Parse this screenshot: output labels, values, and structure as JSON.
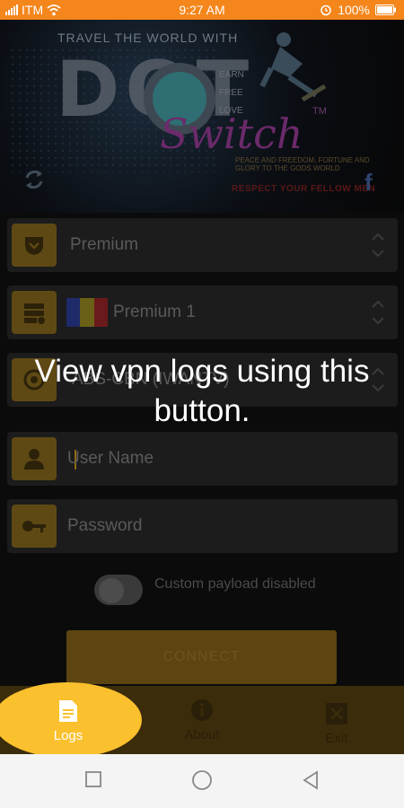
{
  "status_bar": {
    "carrier": "ITM",
    "time": "9:27 AM",
    "battery": "100%",
    "icons": [
      "signal-icon",
      "wifi-icon",
      "alarm-icon",
      "battery-icon"
    ]
  },
  "banner": {
    "line1": "TRAVEL THE WORLD WITH",
    "dot": "DOT",
    "words": [
      "EARN",
      "FREE",
      "LOVE"
    ],
    "switch": "Switch",
    "tm": "TM",
    "tagline": "PEACE AND FREEDOM, FORTUNE AND GLORY TO THE GODS WORLD",
    "tagline2": "RESPECT YOUR FELLOW MEN"
  },
  "form": {
    "plan": "Premium",
    "server": "Premium 1",
    "network": "ABS-CBN (IWANTV)",
    "username_placeholder": "User Name",
    "password_placeholder": "Password",
    "payload_label": "Custom payload disabled",
    "connect_label": "CONNECT"
  },
  "nav": {
    "logs": "Logs",
    "about": "About",
    "exit": "Exit"
  },
  "overlay": {
    "message": "View vpn logs using this button."
  },
  "colors": {
    "accent": "#fbc02d",
    "status_bar": "#f4861c"
  }
}
